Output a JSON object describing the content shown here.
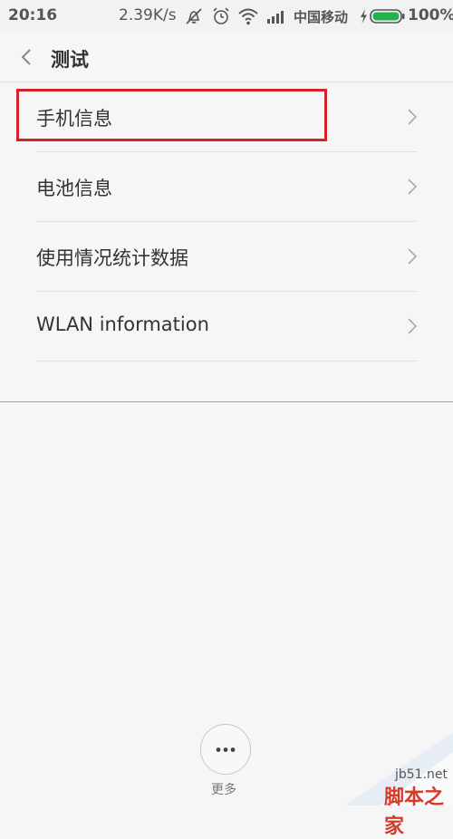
{
  "status_bar": {
    "time": "20:16",
    "net_speed": "2.39K/s",
    "carrier": "中国移动",
    "battery_percent": "100%",
    "icons": [
      "silent-vibrate-icon",
      "alarm-icon",
      "wifi-icon",
      "signal-icon",
      "charging-icon",
      "battery-icon"
    ]
  },
  "header": {
    "back_icon": "chevron-left-icon",
    "title": "测试"
  },
  "menu": {
    "items": [
      {
        "label": "手机信息",
        "chevron": "chevron-right-icon"
      },
      {
        "label": "电池信息",
        "chevron": "chevron-right-icon"
      },
      {
        "label": "使用情况统计数据",
        "chevron": "chevron-right-icon"
      },
      {
        "label": "WLAN information",
        "chevron": "chevron-right-icon"
      }
    ]
  },
  "footer": {
    "more_icon": "more-dots-icon",
    "more_label": "更多"
  },
  "watermark": {
    "site": "jb51.net",
    "name": "脚本之家"
  },
  "colors": {
    "highlight_box": "#d2232a",
    "separator": "#e78b80",
    "battery": "#22b14c"
  }
}
